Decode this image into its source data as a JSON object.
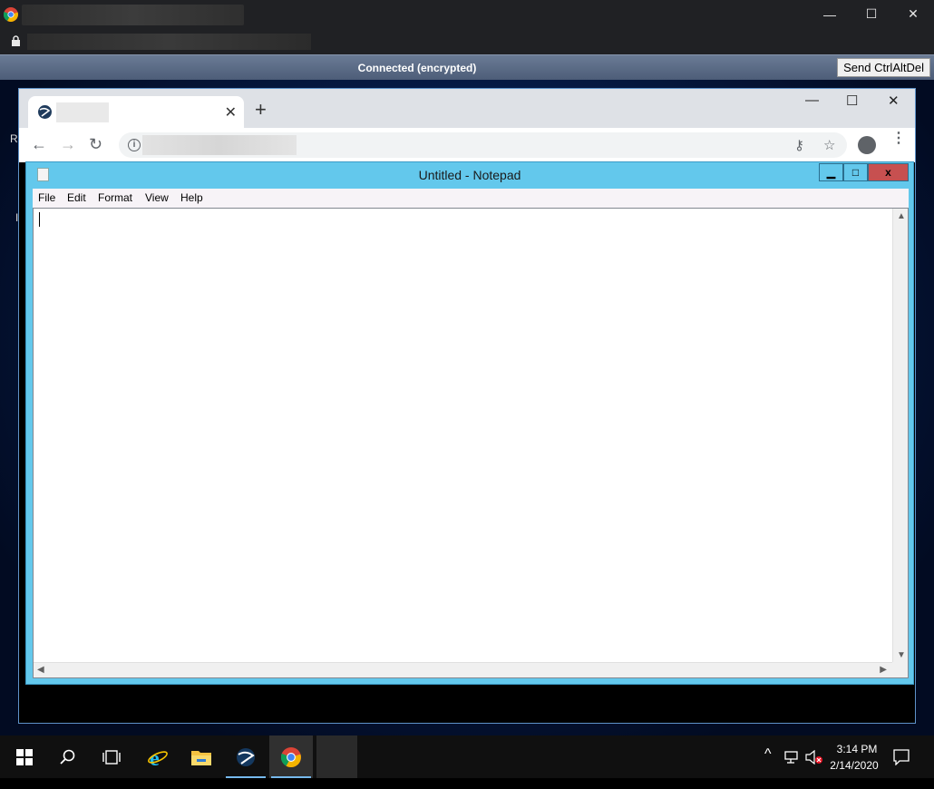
{
  "outer_window": {
    "minimize_glyph": "—",
    "maximize_glyph": "☐",
    "close_glyph": "✕"
  },
  "session": {
    "status": "Connected (encrypted)",
    "cad_label": "Send CtrlAltDel"
  },
  "desktop": {
    "edge_chars": [
      "R",
      "I"
    ]
  },
  "inner_browser": {
    "tab_close_glyph": "✕",
    "new_tab_glyph": "+",
    "minimize_glyph": "—",
    "maximize_glyph": "☐",
    "close_glyph": "✕",
    "back_glyph": "←",
    "forward_glyph": "→",
    "reload_glyph": "↻",
    "info_glyph": "i",
    "key_glyph": "⚷",
    "star_glyph": "☆",
    "menu_glyph": "⋮"
  },
  "notepad": {
    "title": "Untitled - Notepad",
    "min_glyph": "▁",
    "max_glyph": "□",
    "close_glyph": "x",
    "menu": [
      "File",
      "Edit",
      "Format",
      "View",
      "Help"
    ],
    "content": "",
    "scroll_up": "▲",
    "scroll_down": "▼",
    "scroll_left": "◀",
    "scroll_right": "▶"
  },
  "taskbar": {
    "items": [
      "start-icon",
      "search-icon",
      "task-view-icon",
      "internet-explorer-icon",
      "file-explorer-icon",
      "remote-app-icon",
      "chrome-icon"
    ],
    "tray_chevron": "^",
    "clock_time": "3:14 PM",
    "clock_date": "2/14/2020"
  },
  "colors": {
    "notepad_frame": "#63c8ec",
    "close_button": "#c75050",
    "taskbar": "#101010",
    "session_bar": "#5a6b86"
  }
}
